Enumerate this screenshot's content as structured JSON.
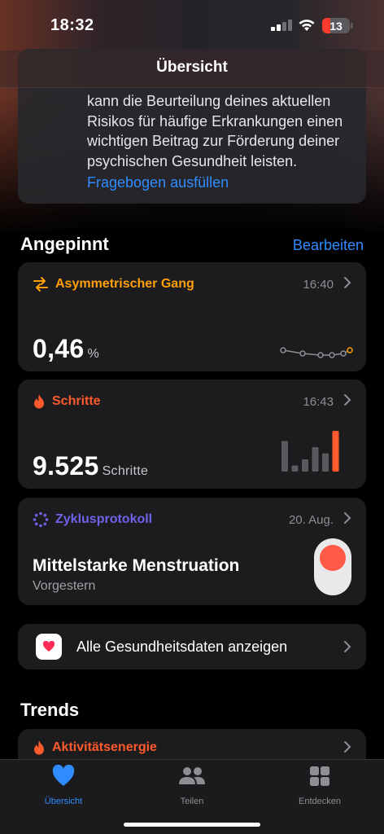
{
  "status": {
    "time": "18:32",
    "battery": "13"
  },
  "nav": {
    "title": "Übersicht"
  },
  "banner": {
    "text": "kann die Beurteilung deines aktuellen Risikos für häufige Erkrankungen einen wichtigen Beitrag zur Förderung deiner psychischen Gesundheit leisten.",
    "link": "Fragebogen ausfüllen"
  },
  "pinned": {
    "title": "Angepinnt",
    "edit": "Bearbeiten",
    "cards": [
      {
        "title": "Asymmetrischer Gang",
        "time": "16:40",
        "value": "0,46",
        "unit": "%",
        "icon": "asymmetry-arrows-icon",
        "color": "#ff9f0a",
        "trend": [
          0.46,
          0.44,
          0.43,
          0.43,
          0.44,
          0.46
        ]
      },
      {
        "title": "Schritte",
        "time": "16:43",
        "value": "9.525",
        "unit": "Schritte",
        "icon": "flame-icon",
        "color": "#ff5a2c",
        "bars": [
          0.75,
          0.15,
          0.3,
          0.6,
          0.45,
          1.0
        ]
      },
      {
        "title": "Zyklusprotokoll",
        "time": "20. Aug.",
        "headline": "Mittelstarke Menstruation",
        "sub": "Vorgestern",
        "icon": "cycle-icon",
        "color": "#6e62e8"
      }
    ]
  },
  "all_data": {
    "label": "Alle Gesundheitsdaten anzeigen"
  },
  "trends": {
    "title": "Trends",
    "card": {
      "title": "Aktivitätsenergie",
      "icon": "flame-icon",
      "color": "#ff5a2c"
    }
  },
  "tabs": [
    {
      "label": "Übersicht",
      "icon": "heart-icon",
      "active": true
    },
    {
      "label": "Teilen",
      "icon": "people-icon",
      "active": false
    },
    {
      "label": "Entdecken",
      "icon": "grid-icon",
      "active": false
    }
  ]
}
